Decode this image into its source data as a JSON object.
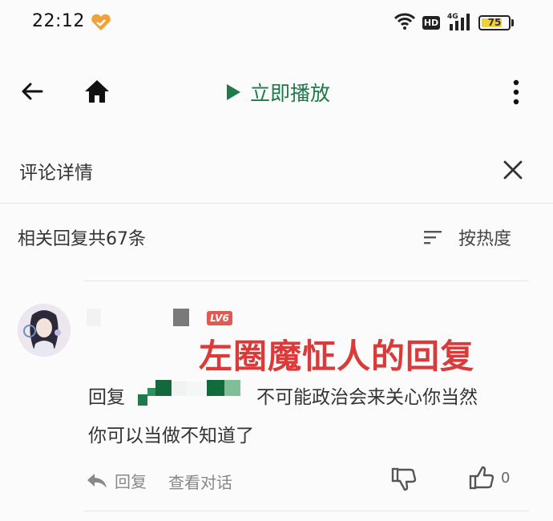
{
  "status_bar": {
    "time": "22:12",
    "hd_label": "HD",
    "network_label": "4G",
    "battery": "75"
  },
  "app_bar": {
    "play_label": "立即播放"
  },
  "sheet": {
    "title": "评论详情"
  },
  "replies": {
    "count_label": "相关回复共67条",
    "sort_label": "按热度"
  },
  "comment": {
    "level_badge": "LV6",
    "overlay_caption": "左圈魔怔人的回复",
    "reply_prefix": "回复",
    "text_line1": "不可能政治会来关心你当然",
    "text_line2": "你可以当做不知道了",
    "reply_action": "回复",
    "view_conversation": "查看对话",
    "like_count": "0"
  },
  "colors": {
    "accent_green": "#1e7a4a",
    "overlay_red": "#d93b3b",
    "level_badge": "#e05a4f"
  }
}
